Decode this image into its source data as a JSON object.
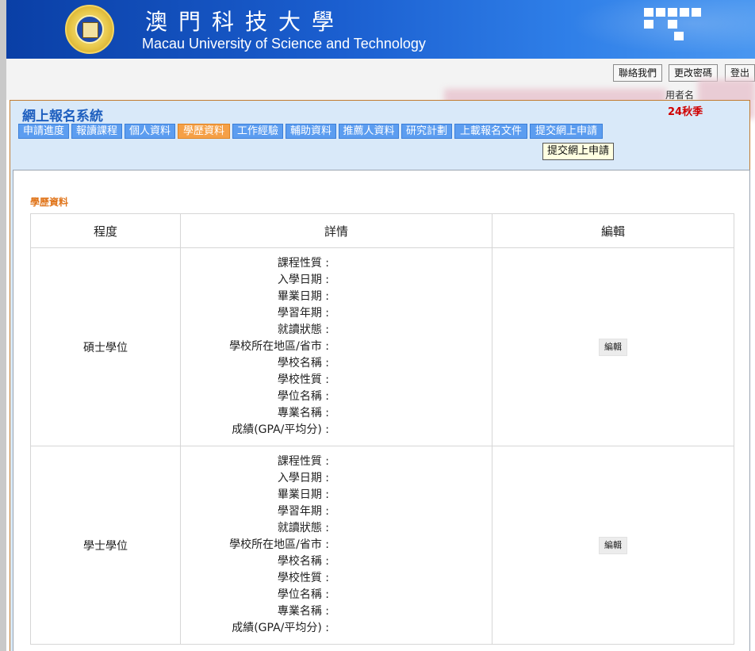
{
  "header": {
    "title_cn": "澳門科技大學",
    "title_en": "Macau University of Science and Technology",
    "logo_text": "格意物誠",
    "banner_color": "#1b5fd0"
  },
  "top_actions": {
    "contact": "聯絡我們",
    "change_password": "更改密碼",
    "logout": "登出"
  },
  "user": {
    "label": "用者名",
    "session": "24秋季"
  },
  "system": {
    "title": "網上報名系統",
    "tabs": [
      {
        "label": "申請進度"
      },
      {
        "label": "報讀課程"
      },
      {
        "label": "個人資料"
      },
      {
        "label": "學歷資料"
      },
      {
        "label": "工作經驗"
      },
      {
        "label": "輔助資料"
      },
      {
        "label": "推薦人資料"
      },
      {
        "label": "研究計劃"
      },
      {
        "label": "上載報名文件"
      },
      {
        "label": "提交網上申請"
      }
    ],
    "active_tab": "學歷資料",
    "tooltip": "提交網上申請",
    "accent_color": "#f5a047",
    "tab_color": "#5c9df0"
  },
  "education": {
    "section_title": "學歷資料",
    "columns": [
      "程度",
      "詳情",
      "編輯"
    ],
    "field_labels": [
      "課程性質 :",
      "入學日期 :",
      "畢業日期 :",
      "學習年期 :",
      "就讀狀態 :",
      "學校所在地區/省市 :",
      "學校名稱 :",
      "學校性質 :",
      "學位名稱 :",
      "專業名稱 :",
      "成績(GPA/平均分) :"
    ],
    "rows": [
      {
        "level": "碩士學位",
        "edit_label": "編輯"
      },
      {
        "level": "學士學位",
        "edit_label": "編輯"
      }
    ]
  }
}
